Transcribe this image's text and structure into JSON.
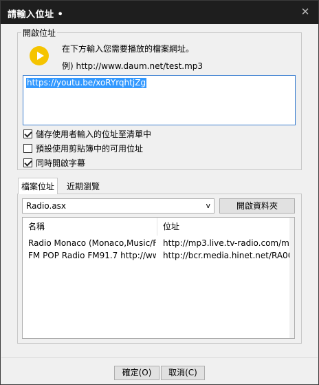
{
  "window": {
    "title": "請輸入位址 •",
    "close_glyph": "✕"
  },
  "open_group": {
    "label": "開啟位址",
    "instruction": "在下方輸入您需要播放的檔案網址。",
    "example": "例) http://www.daum.net/test.mp3",
    "url_value": "https://youtu.be/xoRYrqhtjZg"
  },
  "options": [
    {
      "label": "儲存使用者輸入的位址至清單中",
      "checked": true
    },
    {
      "label": "預設使用剪貼簿中的可用位址",
      "checked": false
    },
    {
      "label": "同時開啟字幕",
      "checked": true
    }
  ],
  "tabs": [
    {
      "label": "檔案位址",
      "active": true
    },
    {
      "label": "近期瀏覽",
      "active": false
    }
  ],
  "file_panel": {
    "combo_value": "Radio.asx",
    "combo_arrow": "v",
    "open_folder_label": "開啟資料夾",
    "columns": [
      "名稱",
      "位址"
    ],
    "rows": [
      [
        "Radio Monaco (Monaco,Music/F...",
        "http://mp3.live.tv-radio.com/mc..."
      ],
      [
        "FM POP Radio FM91.7 http://ww...",
        "http://bcr.media.hinet.net/RA000..."
      ]
    ]
  },
  "footer": {
    "ok_label": "確定(O)",
    "cancel_label": "取消(C)"
  }
}
